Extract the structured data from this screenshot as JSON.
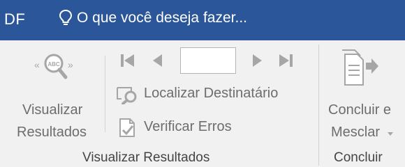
{
  "titlebar": {
    "left_fragment": "DF",
    "tell_me_placeholder": "O que você deseja fazer..."
  },
  "groups": {
    "preview": {
      "label": "Visualizar Resultados",
      "preview_button": {
        "line1": "Visualizar",
        "line2": "Resultados",
        "icon": "preview-results-icon"
      },
      "record_nav": {
        "first": "first-record-icon",
        "previous": "previous-record-icon",
        "next": "next-record-icon",
        "last": "last-record-icon",
        "record_value": ""
      },
      "find_recipient": {
        "label": "Localizar Destinatário",
        "icon": "find-recipient-icon"
      },
      "check_errors": {
        "label": "Verificar Erros",
        "icon": "check-errors-icon"
      }
    },
    "finish": {
      "label": "Concluir",
      "finish_merge_button": {
        "line1": "Concluir e",
        "line2": "Mesclar",
        "dropdown_icon": "chevron-down-icon",
        "icon": "finish-merge-icon"
      }
    }
  },
  "colors": {
    "title_bar": "#2b579a",
    "ribbon_bg": "#f1f1f1",
    "disabled_text": "#6d6d6d",
    "disabled_icon": "#a6a6a6"
  }
}
